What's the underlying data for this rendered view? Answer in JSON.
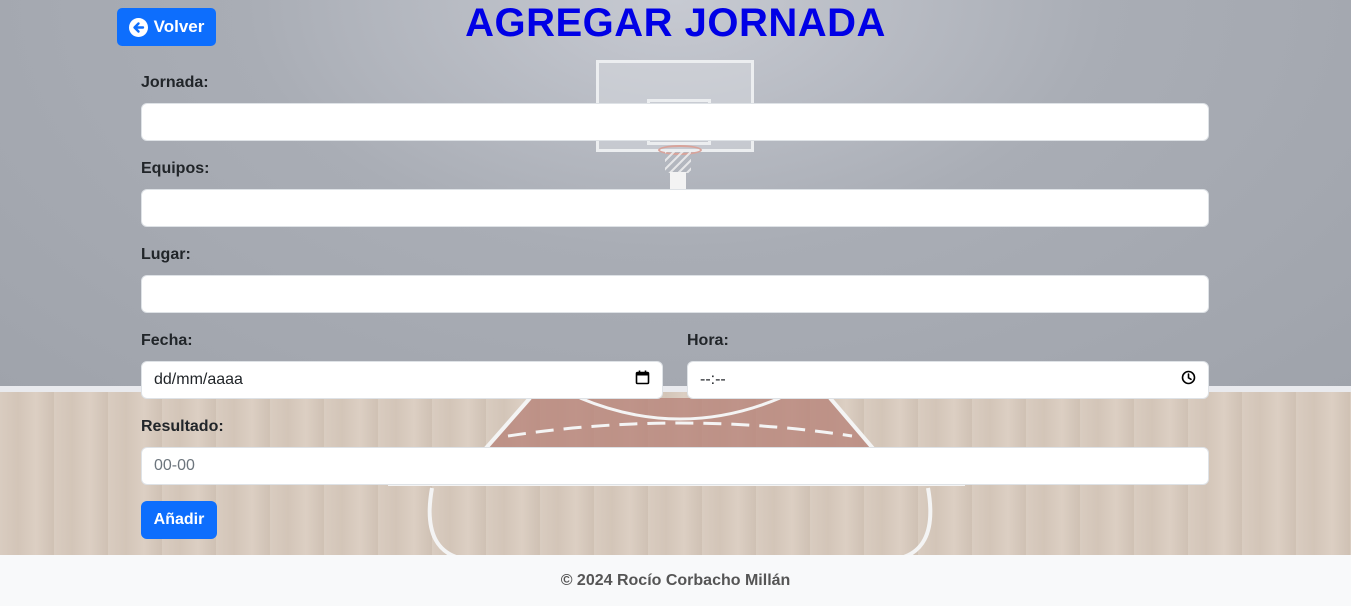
{
  "header": {
    "back_label": "Volver",
    "title": "AGREGAR JORNADA"
  },
  "form": {
    "jornada_label": "Jornada:",
    "equipos_label": "Equipos:",
    "lugar_label": "Lugar:",
    "fecha_label": "Fecha:",
    "fecha_placeholder": "dd/mm/aaaa",
    "hora_label": "Hora:",
    "hora_placeholder": "--:--",
    "resultado_label": "Resultado:",
    "resultado_placeholder": "00-00",
    "submit_label": "Añadir"
  },
  "footer": {
    "text": "© 2024 Rocío Corbacho Millán"
  },
  "colors": {
    "primary": "#0d6efd",
    "title": "#0000e6",
    "footer_bg": "#f8f9fa"
  },
  "icons": {
    "back": "arrow-left-circle-icon",
    "calendar": "calendar-icon",
    "clock": "clock-icon"
  }
}
